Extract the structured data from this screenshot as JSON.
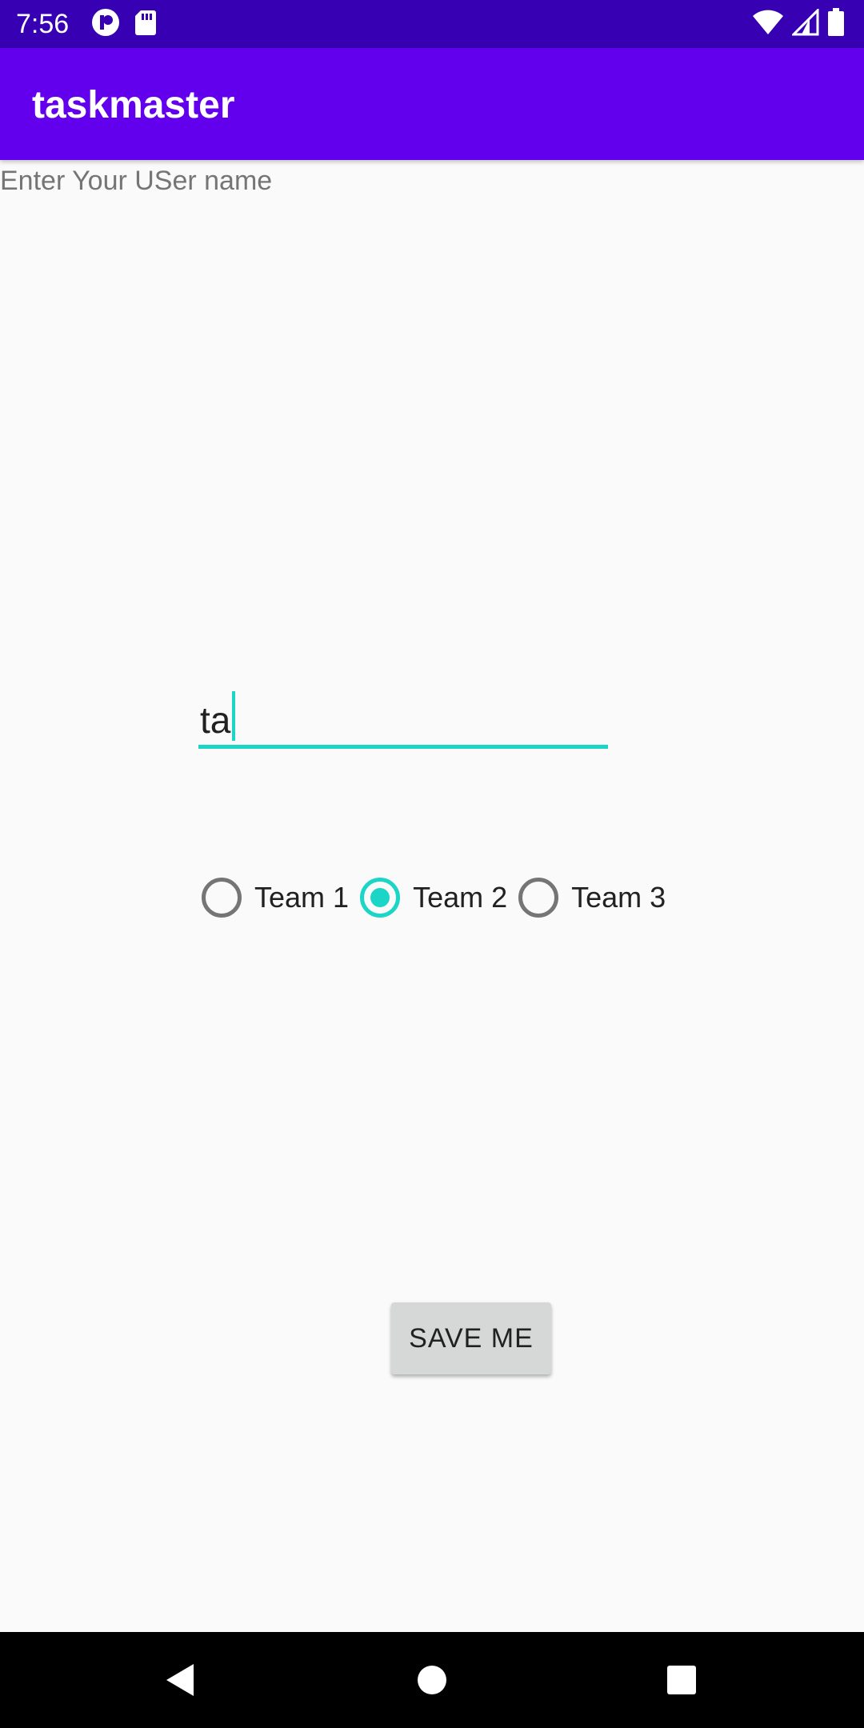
{
  "status_bar": {
    "time": "7:56",
    "icons_left": [
      "media-app-icon",
      "sd-card-icon"
    ],
    "icons_right": [
      "wifi-icon",
      "cell-signal-icon",
      "battery-icon"
    ]
  },
  "app_bar": {
    "title": "taskmaster"
  },
  "form": {
    "username_label": "Enter Your USer name",
    "name_value": "ta",
    "teams": [
      {
        "label": "Team 1",
        "checked": false
      },
      {
        "label": "Team 2",
        "checked": true
      },
      {
        "label": "Team 3",
        "checked": false
      }
    ],
    "save_label": "SAVE ME"
  },
  "nav_bar": {
    "buttons": [
      "back-icon",
      "home-icon",
      "recents-icon"
    ]
  },
  "colors": {
    "status_bar": "#3700b3",
    "app_bar": "#6200ee",
    "accent": "#1bd6c6",
    "button": "#d6d7d7"
  }
}
